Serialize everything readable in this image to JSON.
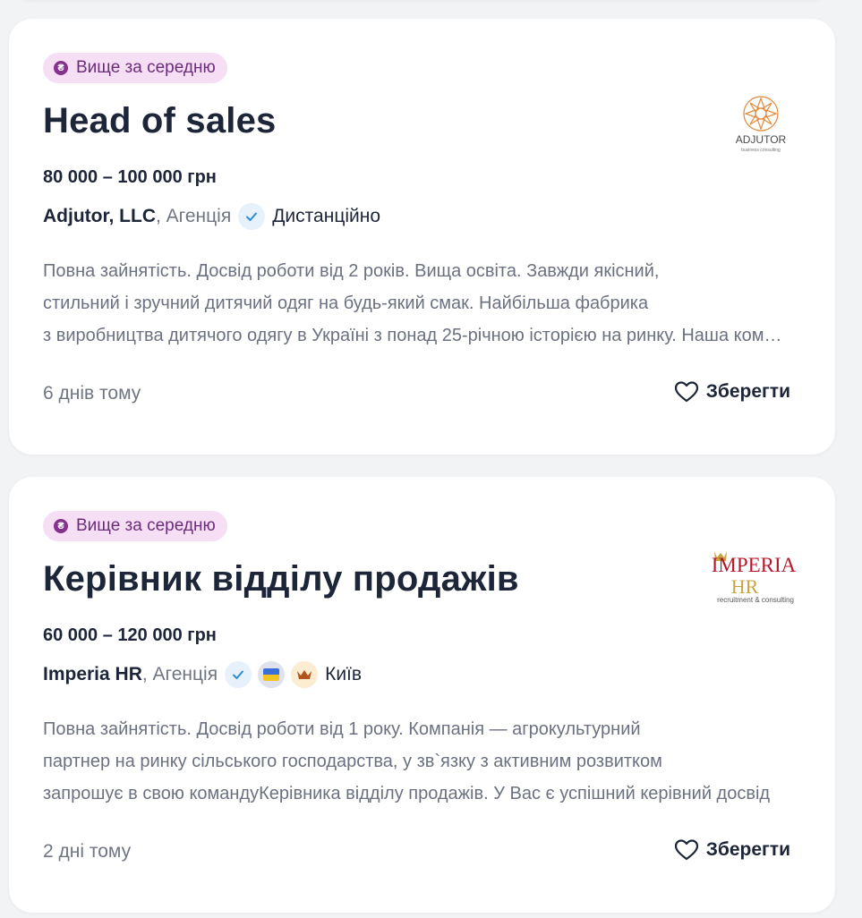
{
  "jobs": [
    {
      "badge": "Вище за середню",
      "badge_symbol": "₴",
      "title": "Head of sales",
      "salary": "80 000 – 100 000 грн",
      "company": "Adjutor, LLC",
      "company_type": ", Агенція",
      "location": "Дистанційно",
      "description_lines": [
        "Повна зайнятість. Досвід роботи від 2 років. Вища освіта. Завжди якісний,",
        "стильний і зручний дитячий одяг на будь-який смак. Найбільша фабрика",
        "з виробництва дитячого одягу в Україні з понад 25-річною історією на ринку. Наша команда"
      ],
      "posted": "6 днів тому",
      "save_label": "Зберегти",
      "logo": {
        "name": "ADJUTOR",
        "tagline": "business consulting",
        "color": "#e38a3d"
      },
      "badges": [
        "verified-icon"
      ]
    },
    {
      "badge": "Вище за середню",
      "badge_symbol": "₴",
      "title": "Керівник відділу продажів",
      "salary": "60 000 – 120 000 грн",
      "company": "Imperia HR",
      "company_type": ", Агенція",
      "location": "Київ",
      "description_lines": [
        "Повна зайнятість. Досвід роботи від 1 року. Компанія — агрокультурний",
        "партнер на ринку сільського господарства, у зв`язку з активним розвитком",
        "запрошує в свою командуКерівника відділу продажів. У Вас є успішний керівний досвід"
      ],
      "posted": "2 дні тому",
      "save_label": "Зберегти",
      "logo": {
        "name": "IMPERIA",
        "sub": "HR",
        "tagline": "recruitment & consulting",
        "color": "#b5182b",
        "accent": "#c9a443"
      },
      "badges": [
        "verified-icon",
        "ukraine-flag-icon",
        "crown-icon"
      ]
    }
  ],
  "colors": {
    "badge_bg": "#f6dff5",
    "badge_text": "#6a2d7a",
    "title": "#1d2538",
    "muted": "#6f7583",
    "verified": "#2b8fd6"
  }
}
